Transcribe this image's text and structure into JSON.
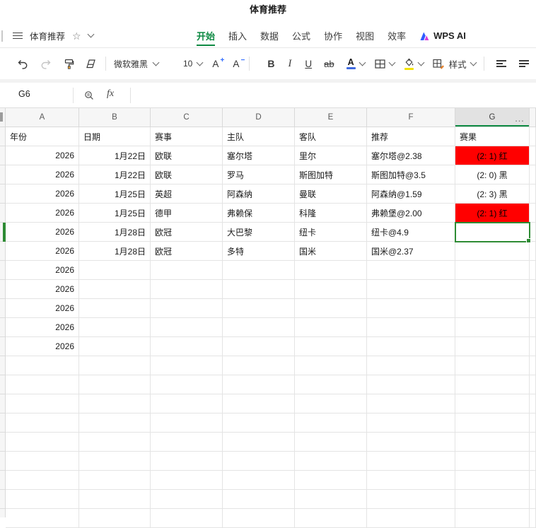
{
  "window": {
    "title": "体育推荐"
  },
  "menu": {
    "doc_name": "体育推荐",
    "tabs": [
      {
        "label": "开始",
        "active": true
      },
      {
        "label": "插入"
      },
      {
        "label": "数据"
      },
      {
        "label": "公式"
      },
      {
        "label": "协作"
      },
      {
        "label": "视图"
      },
      {
        "label": "效率"
      },
      {
        "label": "WPS AI"
      }
    ]
  },
  "toolbar": {
    "font_name": "微软雅黑",
    "font_size": "10",
    "increase_font_label": "A",
    "decrease_font_label": "A",
    "bold_label": "B",
    "italic_label": "I",
    "underline_label": "U",
    "strikethrough_label": "ab",
    "font_color_label": "A",
    "style_label": "样式"
  },
  "formula_bar": {
    "name_box": "G6",
    "fx_label": "fx"
  },
  "grid": {
    "selected_cell": "G6",
    "col_letters": [
      "A",
      "B",
      "C",
      "D",
      "E",
      "F",
      "G"
    ],
    "more_button": "…",
    "rows": [
      [
        "年份",
        "日期",
        "赛事",
        "主队",
        "客队",
        "推荐",
        "赛果"
      ],
      [
        "2026",
        "1月22日",
        "欧联",
        "塞尔塔",
        "里尔",
        "塞尔塔@2.38",
        "(2: 1) 红"
      ],
      [
        "2026",
        "1月22日",
        "欧联",
        "罗马",
        "斯图加特",
        "斯图加特@3.5",
        "(2: 0) 黑"
      ],
      [
        "2026",
        "1月25日",
        "英超",
        "阿森纳",
        "曼联",
        "阿森纳@1.59",
        "(2: 3) 黑"
      ],
      [
        "2026",
        "1月25日",
        "德甲",
        "弗赖保",
        "科隆",
        "弗赖堡@2.00",
        "(2: 1) 红"
      ],
      [
        "2026",
        "1月28日",
        "欧冠",
        "大巴黎",
        "纽卡",
        "纽卡@4.9",
        ""
      ],
      [
        "2026",
        "1月28日",
        "欧冠",
        "多特",
        "国米",
        "国米@2.37",
        ""
      ],
      [
        "2026",
        "",
        "",
        "",
        "",
        "",
        ""
      ],
      [
        "2026",
        "",
        "",
        "",
        "",
        "",
        ""
      ],
      [
        "2026",
        "",
        "",
        "",
        "",
        "",
        ""
      ],
      [
        "2026",
        "",
        "",
        "",
        "",
        "",
        ""
      ],
      [
        "2026",
        "",
        "",
        "",
        "",
        "",
        ""
      ]
    ],
    "red_result_rows": [
      1,
      4
    ],
    "visible_row_count": 21
  },
  "colors": {
    "accent_green": "#0e8a43",
    "selection_green": "#2e8b34",
    "result_red": "#ff0000",
    "font_color_blue": "#3f6ae0",
    "highlight_yellow": "#f2e202"
  }
}
